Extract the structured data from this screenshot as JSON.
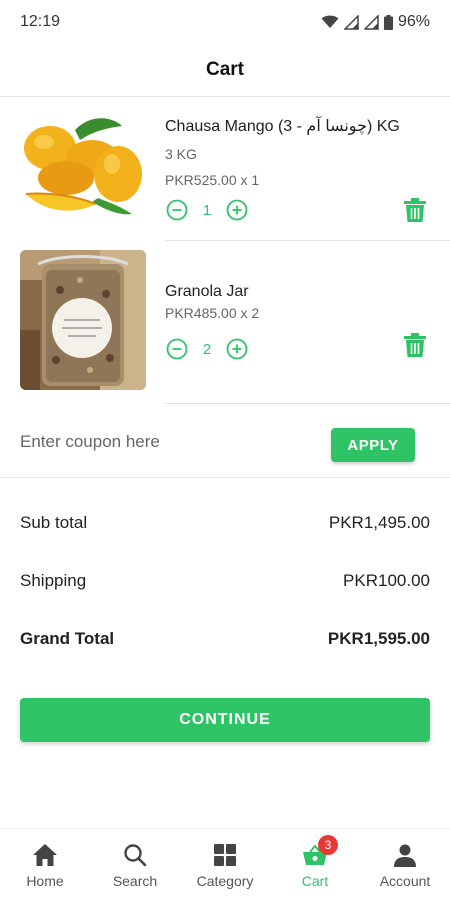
{
  "status_bar": {
    "time": "12:19",
    "battery": "96%"
  },
  "header": {
    "title": "Cart"
  },
  "cart": {
    "items": [
      {
        "name": "Chausa Mango (3 - چونسا آم) KG",
        "variant": "3 KG",
        "price_line": "PKR525.00 x 1",
        "quantity": "1"
      },
      {
        "name": "Granola Jar",
        "variant": "",
        "price_line": "PKR485.00 x 2",
        "quantity": "2"
      }
    ]
  },
  "coupon": {
    "placeholder": "Enter coupon here",
    "apply_label": "APPLY"
  },
  "totals": {
    "subtotal_label": "Sub total",
    "subtotal_value": "PKR1,495.00",
    "shipping_label": "Shipping",
    "shipping_value": "PKR100.00",
    "grand_label": "Grand Total",
    "grand_value": "PKR1,595.00"
  },
  "continue_label": "CONTINUE",
  "nav": {
    "items": [
      {
        "label": "Home",
        "icon": "home-icon"
      },
      {
        "label": "Search",
        "icon": "search-icon"
      },
      {
        "label": "Category",
        "icon": "category-icon"
      },
      {
        "label": "Cart",
        "icon": "cart-icon",
        "badge": "3"
      },
      {
        "label": "Account",
        "icon": "account-icon"
      }
    ]
  },
  "colors": {
    "accent": "#2ec466",
    "badge": "#e53935"
  }
}
